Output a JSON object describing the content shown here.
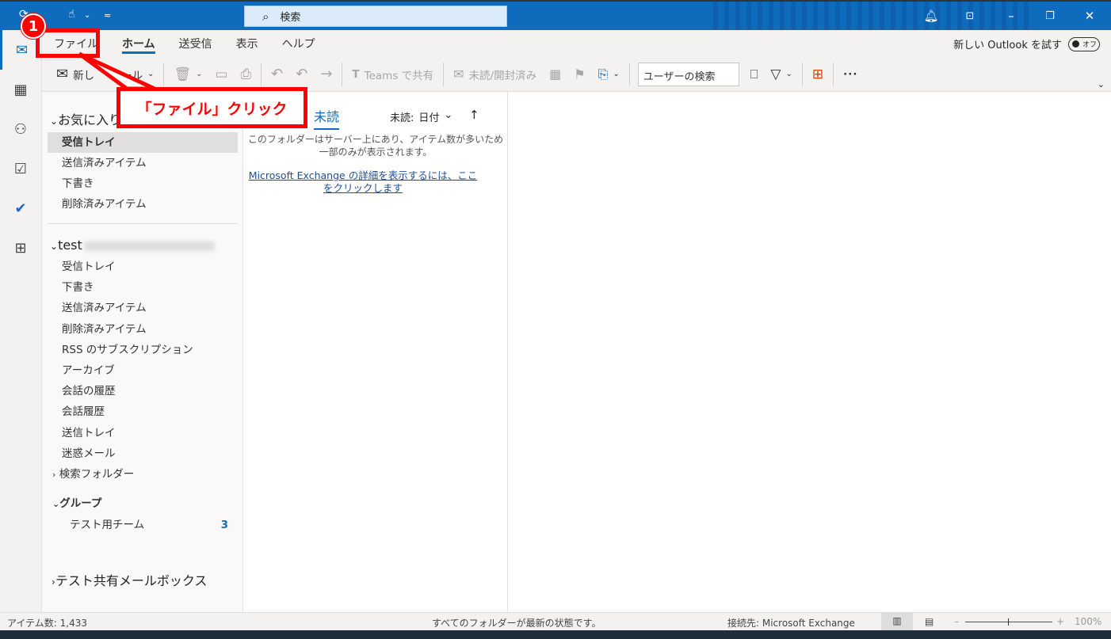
{
  "colors": {
    "accent": "#0f6cbd",
    "annotation": "#ff0000"
  },
  "titlebar": {
    "search_placeholder": "検索",
    "icons": [
      "bell-icon",
      "ribbon-display-icon",
      "minimize-icon",
      "restore-icon",
      "close-icon"
    ]
  },
  "tabs": [
    {
      "label": "ファイル"
    },
    {
      "label": "ホーム",
      "active": true
    },
    {
      "label": "送受信"
    },
    {
      "label": "表示"
    },
    {
      "label": "ヘルプ"
    }
  ],
  "try_new": {
    "label": "新しい Outlook を試す",
    "toggle": "オフ",
    "enabled": false
  },
  "toolbar": {
    "new_mail": "新し",
    "new_mail_tail": "ール",
    "teams_share": "Teams で共有",
    "read_unread": "未読/開封済み",
    "user_search_placeholder": "ユーザーの検索"
  },
  "folders": {
    "favorites_header": "お気に入り",
    "favorites": [
      {
        "label": "受信トレイ",
        "selected": true
      },
      {
        "label": "送信済みアイテム"
      },
      {
        "label": "下書き"
      },
      {
        "label": "削除済みアイテム"
      }
    ],
    "account_header": "test",
    "account_items": [
      "受信トレイ",
      "下書き",
      "送信済みアイテム",
      "削除済みアイテム",
      "RSS のサブスクリプション",
      "アーカイブ",
      "会話の履歴",
      "会話履歴",
      "送信トレイ",
      "迷惑メール"
    ],
    "search_folders": "検索フォルダー",
    "groups_header": "グループ",
    "groups": [
      {
        "label": "テスト用チーム",
        "count": "3"
      }
    ],
    "shared_mailbox": "テスト共有メールボックス"
  },
  "list": {
    "tab_unread": "未読",
    "sort_label": "未読:",
    "sort_value": "日付",
    "sort_dir": "↑",
    "notice_line1": "このフォルダーはサーバー上にあり、アイテム数が多いため",
    "notice_line2": "一部のみが表示されます。",
    "link_line1": "Microsoft Exchange の詳細を表示するには、ここ",
    "link_line2": "をクリックします"
  },
  "status": {
    "items": "アイテム数: 1,433",
    "sync": "すべてのフォルダーが最新の状態です。",
    "connection": "接続先: Microsoft Exchange",
    "zoom": "100%"
  },
  "annotation": {
    "number": "1",
    "text": "「ファイル」クリック"
  }
}
